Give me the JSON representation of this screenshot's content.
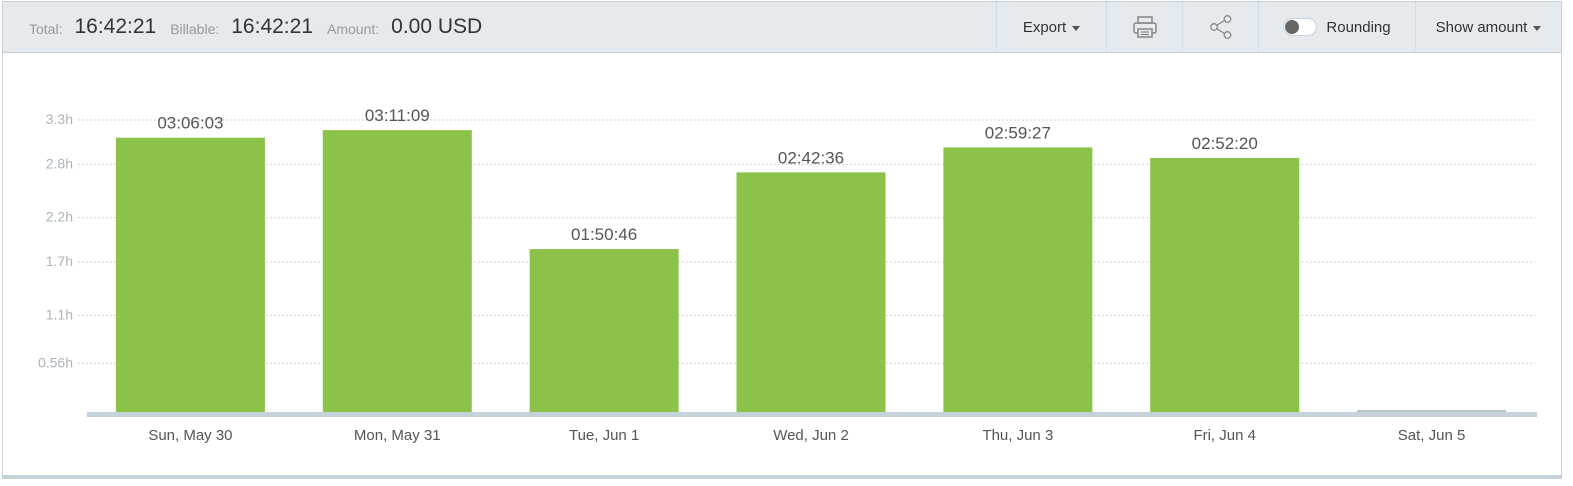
{
  "summary": {
    "total_label": "Total:",
    "total_value": "16:42:21",
    "billable_label": "Billable:",
    "billable_value": "16:42:21",
    "amount_label": "Amount:",
    "amount_value": "0.00 USD"
  },
  "toolbar": {
    "export_label": "Export",
    "print_icon": "printer-icon",
    "share_icon": "share-icon",
    "rounding_label": "Rounding",
    "rounding_enabled": false,
    "show_amount_label": "Show amount"
  },
  "chart_data": {
    "type": "bar",
    "categories": [
      "Sun, May 30",
      "Mon, May 31",
      "Tue, Jun 1",
      "Wed, Jun 2",
      "Thu, Jun 3",
      "Fri, Jun 4",
      "Sat, Jun 5"
    ],
    "values": [
      3.1008,
      3.1858,
      1.8461,
      2.71,
      2.9908,
      2.8722,
      0
    ],
    "data_labels": [
      "03:06:03",
      "03:11:09",
      "01:50:46",
      "02:42:36",
      "02:59:27",
      "02:52:20",
      ""
    ],
    "yticks": [
      "0.56h",
      "1.1h",
      "1.7h",
      "2.2h",
      "2.8h",
      "3.3h"
    ],
    "ylim": [
      0,
      3.36
    ],
    "grid": true,
    "bar_color": "#8bc34a",
    "empty_bar_color": "#c6d2d9"
  }
}
